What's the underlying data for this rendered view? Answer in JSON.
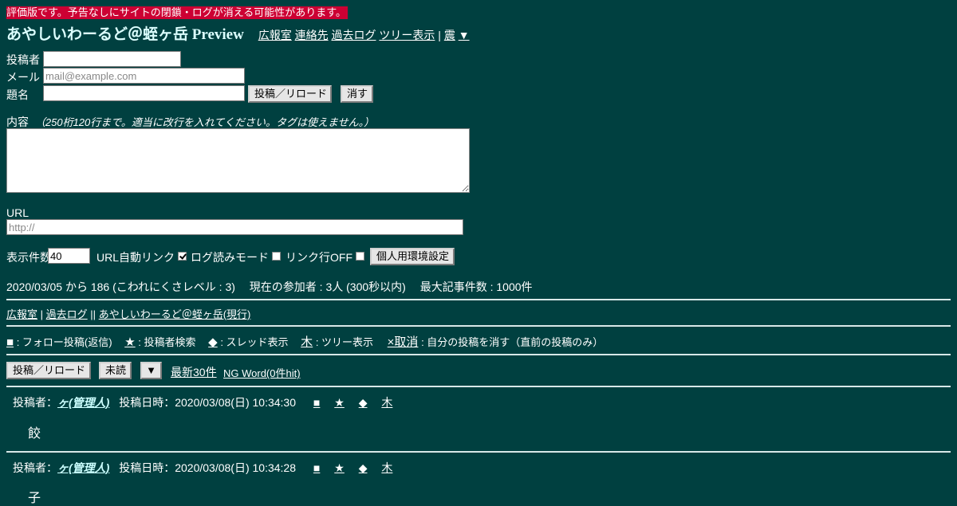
{
  "notice": "評価版です。予告なしにサイトの閉鎖・ログが消える可能性があります。",
  "header": {
    "title": "あやしいわーるど＠蛭ヶ岳 Preview",
    "links": [
      "広報室",
      "連絡先",
      "過去ログ",
      "ツリー表示"
    ],
    "separator": "|",
    "quake_link": "震",
    "menu_arrow": "▼"
  },
  "form": {
    "author_label": "投稿者",
    "author_value": "",
    "email_label": "メール",
    "email_placeholder": "mail@example.com",
    "subject_label": "題名",
    "subject_value": "",
    "post_button": "投稿／リロード",
    "clear_button": "消す",
    "content_label": "内容",
    "content_hint": "（250桁120行まで。適当に改行を入れてください。タグは使えません。）",
    "content_value": "",
    "url_label": "URL",
    "url_placeholder": "http://"
  },
  "options": {
    "display_count_label": "表示件数",
    "display_count_value": "40",
    "auto_link_label": "URL自動リンク",
    "auto_link_checked": true,
    "log_read_label": "ログ読みモード",
    "log_read_checked": false,
    "link_off_label": "リンク行OFF",
    "link_off_checked": false,
    "personal_settings_button": "個人用環境設定"
  },
  "stats": {
    "since": "2020/03/05 から 186 (こわれにくさレベル : 3)",
    "participants": "現在の参加者 : 3人 (300秒以内)",
    "max_posts": "最大記事件数 : 1000件"
  },
  "nav": {
    "links": [
      "広報室",
      "過去ログ"
    ],
    "sep1": "|",
    "sep2": "||",
    "current": "あやしいわーるど＠蛭ヶ岳(現行)"
  },
  "legend": {
    "follow_key": "■",
    "follow_desc": ": フォロー投稿(返信)",
    "search_key": "★",
    "search_desc": ": 投稿者検索",
    "thread_key": "◆",
    "thread_desc": ": スレッド表示",
    "tree_key": "木",
    "tree_desc": ": ツリー表示",
    "cancel_key": "×取消",
    "cancel_desc": ": 自分の投稿を消す（直前の投稿のみ）"
  },
  "actions": {
    "post_button": "投稿／リロード",
    "unread_button": "未読",
    "menu_button": "▼",
    "latest_link": "最新30件",
    "ng_word_link": "NG Word(0件hit)"
  },
  "posts": [
    {
      "author_label": "投稿者：",
      "author": "ヶ(管理人)",
      "date_label": "投稿日時：",
      "date": "2020/03/08(日) 10:34:30",
      "marks": [
        "■",
        "★",
        "◆",
        "木"
      ],
      "body": "餃"
    },
    {
      "author_label": "投稿者：",
      "author": "ヶ(管理人)",
      "date_label": "投稿日時：",
      "date": "2020/03/08(日) 10:34:28",
      "marks": [
        "■",
        "★",
        "◆",
        "木"
      ],
      "body": "子"
    }
  ]
}
